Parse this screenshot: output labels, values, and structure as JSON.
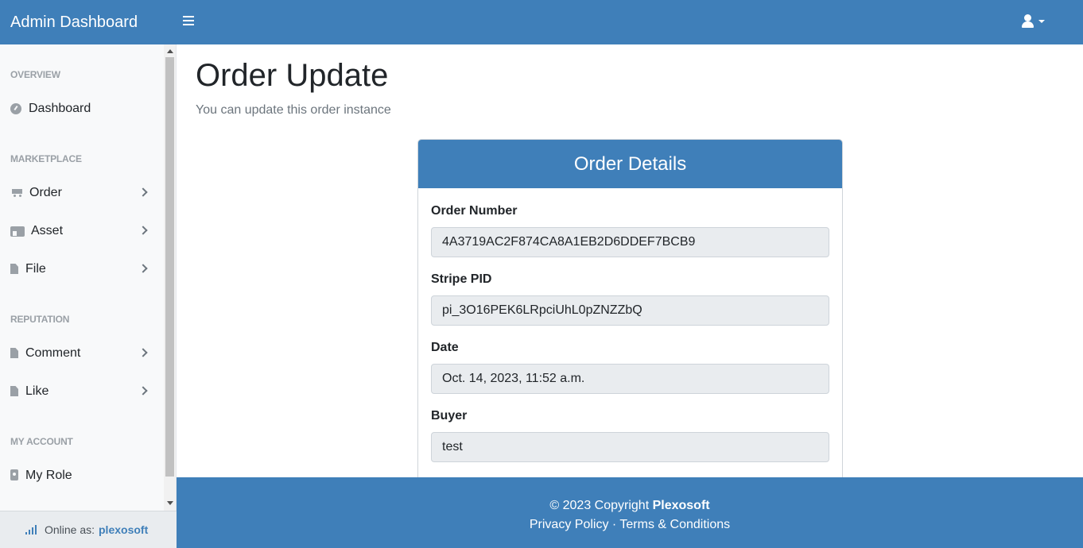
{
  "header": {
    "brand": "Admin Dashboard",
    "menu_toggle_icon": "hamburger-icon",
    "user_icon": "user-icon"
  },
  "sidebar": {
    "sections": {
      "overview": "OVERVIEW",
      "marketplace": "MARKETPLACE",
      "reputation": "REPUTATION",
      "my_account": "MY ACCOUNT"
    },
    "items": [
      {
        "label": "Dashboard",
        "icon": "dashboard-icon"
      },
      {
        "label": "Order",
        "icon": "cart-icon"
      },
      {
        "label": "Asset",
        "icon": "store-icon"
      },
      {
        "label": "File",
        "icon": "file-icon"
      },
      {
        "label": "Comment",
        "icon": "file-icon"
      },
      {
        "label": "Like",
        "icon": "file-icon"
      },
      {
        "label": "My Role",
        "icon": "id-badge-icon"
      }
    ],
    "footer": {
      "online_label": "Online as:",
      "username": "plexosoft"
    }
  },
  "page": {
    "title": "Order Update",
    "subtitle": "You can update this order instance"
  },
  "card": {
    "title": "Order Details",
    "fields": [
      {
        "label": "Order Number",
        "value": "4A3719AC2F874CA8A1EB2D6DDEF7BCB9"
      },
      {
        "label": "Stripe PID",
        "value": "pi_3O16PEK6LRpciUhL0pZNZZbQ"
      },
      {
        "label": "Date",
        "value": "Oct. 14, 2023, 11:52 a.m."
      },
      {
        "label": "Buyer",
        "value": "test"
      }
    ]
  },
  "footer": {
    "copyright": "© 2023 Copyright",
    "company": "Plexosoft",
    "privacy": "Privacy Policy",
    "separator": "·",
    "terms": "Terms & Conditions"
  },
  "colors": {
    "primary": "#3f7fb9",
    "sidebar_bg": "#f8f9fa",
    "input_bg": "#e9ecef"
  }
}
